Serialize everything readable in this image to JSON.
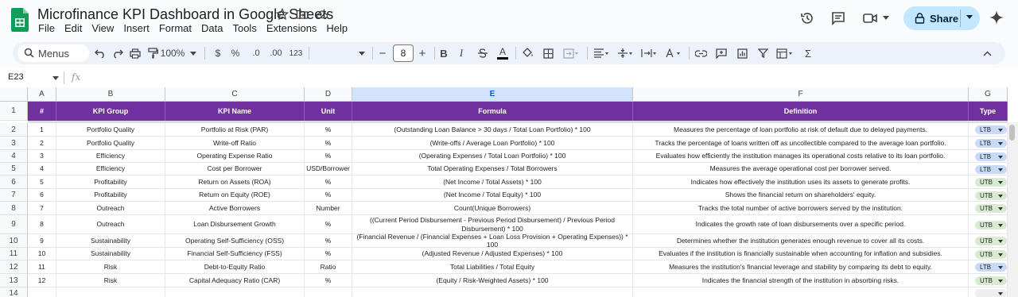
{
  "doc": {
    "title": "Microfinance KPI Dashboard in Google Sheets",
    "menu": [
      "File",
      "Edit",
      "View",
      "Insert",
      "Format",
      "Data",
      "Tools",
      "Extensions",
      "Help"
    ]
  },
  "header_right": {
    "share_label": "Share"
  },
  "toolbar": {
    "menus_label": "Menus",
    "zoom": "100%",
    "currency": "$",
    "percent": "%",
    "dec_decrease": ".0",
    "dec_increase": ".00",
    "number_format": "123",
    "font_size": "8",
    "minus": "−",
    "plus": "+",
    "bold": "B",
    "italic": "I",
    "underline_a": "A",
    "sum": "Σ"
  },
  "formula_bar": {
    "cell_ref": "E23",
    "fx": "fx",
    "value": ""
  },
  "grid": {
    "column_letters": [
      "A",
      "B",
      "C",
      "D",
      "E",
      "F",
      "G"
    ],
    "row_numbers": [
      "1",
      "2",
      "3",
      "4",
      "5",
      "6",
      "7",
      "8",
      "9",
      "10",
      "11",
      "12",
      "13",
      "14"
    ],
    "headers": [
      "#",
      "KPI Group",
      "KPI Name",
      "Unit",
      "Formula",
      "Definition",
      "Type"
    ],
    "rows": [
      {
        "num": "1",
        "group": "Portfolio Quality",
        "name": "Portfolio at Risk (PAR)",
        "unit": "%",
        "formula": "(Outstanding Loan Balance > 30 days / Total Loan Portfolio) * 100",
        "definition": "Measures the percentage of loan portfolio at risk of default due to delayed payments.",
        "type": "LTB"
      },
      {
        "num": "2",
        "group": "Portfolio Quality",
        "name": "Write-off Ratio",
        "unit": "%",
        "formula": "(Write-offs / Average Loan Portfolio) * 100",
        "definition": "Tracks the percentage of loans written off as uncollectible compared to the average loan portfolio.",
        "type": "LTB"
      },
      {
        "num": "3",
        "group": "Efficiency",
        "name": "Operating Expense Ratio",
        "unit": "%",
        "formula": "(Operating Expenses / Total Loan Portfolio) * 100",
        "definition": "Evaluates how efficiently the institution manages its operational costs relative to its loan portfolio.",
        "type": "LTB"
      },
      {
        "num": "4",
        "group": "Efficiency",
        "name": "Cost per Borrower",
        "unit": "USD/Borrower",
        "formula": "Total Operating Expenses / Total Borrowers",
        "definition": "Measures the average operational cost per borrower served.",
        "type": "LTB"
      },
      {
        "num": "5",
        "group": "Profitability",
        "name": "Return on Assets (ROA)",
        "unit": "%",
        "formula": "(Net Income / Total Assets) * 100",
        "definition": "Indicates how effectively the institution uses its assets to generate profits.",
        "type": "UTB"
      },
      {
        "num": "6",
        "group": "Profitability",
        "name": "Return on Equity (ROE)",
        "unit": "%",
        "formula": "(Net Income / Total Equity) * 100",
        "definition": "Shows the financial return on shareholders' equity.",
        "type": "UTB"
      },
      {
        "num": "7",
        "group": "Outreach",
        "name": "Active Borrowers",
        "unit": "Number",
        "formula": "Count(Unique Borrowers)",
        "definition": "Tracks the total number of active borrowers served by the institution.",
        "type": "UTB"
      },
      {
        "num": "8",
        "group": "Outreach",
        "name": "Loan Disbursement Growth",
        "unit": "%",
        "formula": "((Current Period Disbursement - Previous Period Disbursement) / Previous Period Disbursement) * 100",
        "definition": "Indicates the growth rate of loan disbursements over a specific period.",
        "type": "UTB"
      },
      {
        "num": "9",
        "group": "Sustainability",
        "name": "Operating Self-Sufficiency (OSS)",
        "unit": "%",
        "formula": "(Financial Revenue / (Financial Expenses + Loan Loss Provision + Operating Expenses)) * 100",
        "definition": "Determines whether the institution generates enough revenue to cover all its costs.",
        "type": "UTB"
      },
      {
        "num": "10",
        "group": "Sustainability",
        "name": "Financial Self-Sufficiency (FSS)",
        "unit": "%",
        "formula": "(Adjusted Revenue / Adjusted Expenses) * 100",
        "definition": "Evaluates if the institution is financially sustainable when accounting for inflation and subsidies.",
        "type": "UTB"
      },
      {
        "num": "11",
        "group": "Risk",
        "name": "Debt-to-Equity Ratio",
        "unit": "Ratio",
        "formula": "Total Liabilities / Total Equity",
        "definition": "Measures the institution's financial leverage and stability by comparing its debt to equity.",
        "type": "LTB"
      },
      {
        "num": "12",
        "group": "Risk",
        "name": "Capital Adequacy Ratio (CAR)",
        "unit": "%",
        "formula": "(Equity / Risk-Weighted Assets) * 100",
        "definition": "Indicates the financial strength of the institution in absorbing risks.",
        "type": "UTB"
      }
    ]
  },
  "colors": {
    "header_bg": "#7030a0",
    "ltb_chip": "#c9daf8",
    "utb_chip": "#d9ead3",
    "share_bg": "#c2e7ff",
    "selected_col": "#d3e3fd"
  }
}
